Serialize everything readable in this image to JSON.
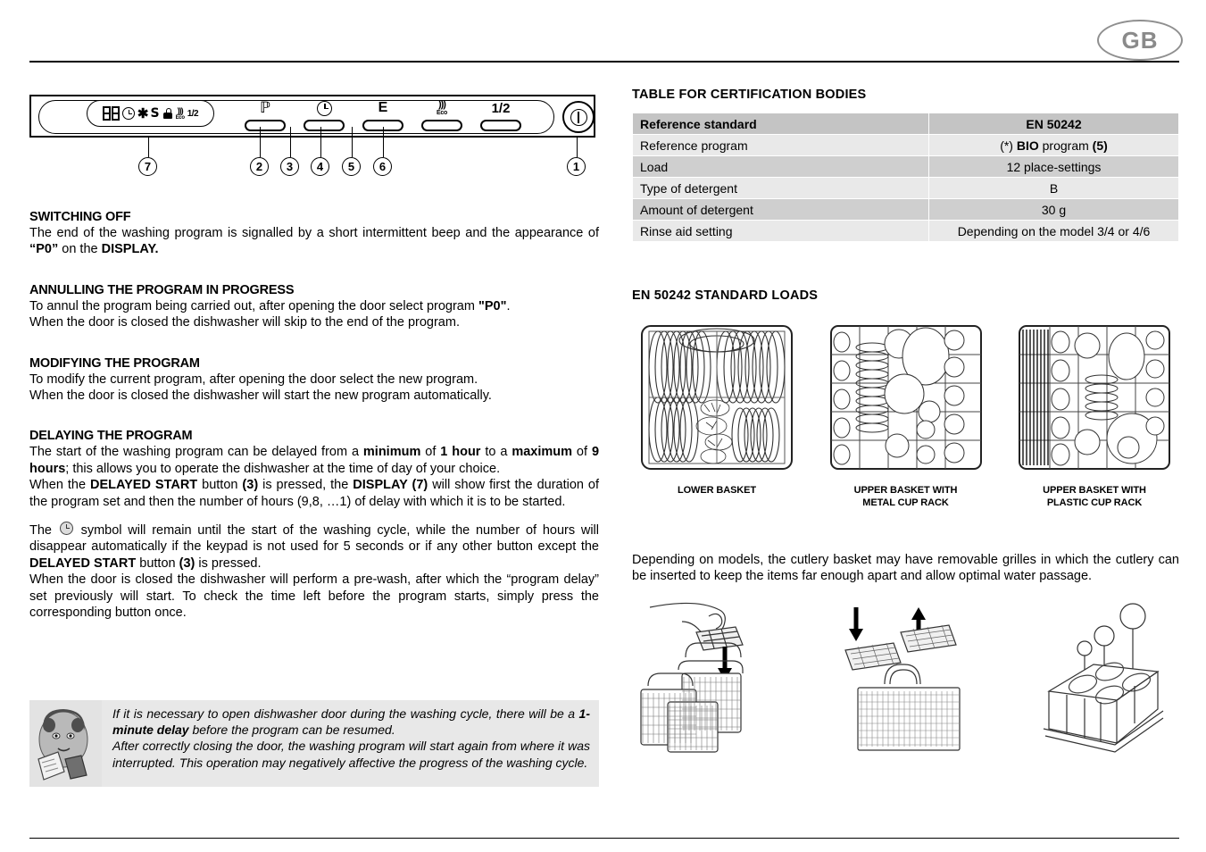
{
  "header": {
    "language_badge": "GB"
  },
  "control_panel": {
    "display_symbols": [
      {
        "name": "seven-segment-digits",
        "label": "88"
      },
      {
        "name": "delay-clock-icon",
        "label": "clock"
      },
      {
        "name": "rinse-aid-star-icon",
        "label": "*"
      },
      {
        "name": "salt-icon",
        "label": "S"
      },
      {
        "name": "tap-water-icon",
        "label": "tap"
      },
      {
        "name": "eco-icon",
        "label": "Eco"
      },
      {
        "name": "half-load-icon",
        "label": "1/2"
      }
    ],
    "buttons": [
      {
        "icon": "P",
        "name": "program-button",
        "callout": "2"
      },
      {
        "icon": "clock",
        "name": "delayed-start-button",
        "callout": "3"
      },
      {
        "icon": "E",
        "name": "extra-button",
        "callout": "4"
      },
      {
        "icon": "Eco",
        "name": "eco-button",
        "callout": "5"
      },
      {
        "icon": "1/2",
        "name": "half-load-button",
        "callout": "6"
      }
    ],
    "power_callout": "1",
    "display_callout": "7"
  },
  "sections": [
    {
      "heading": "SWITCHING OFF",
      "paragraphs": [
        "The end of the washing program is signalled by a short intermittent beep and the appearance of “P0” on the DISPLAY."
      ]
    },
    {
      "heading": "ANNULLING THE PROGRAM IN PROGRESS",
      "paragraphs": [
        "To annul the program being carried out, after opening the door select program \"P0\". When the door is closed the dishwasher will skip to the end of the program."
      ]
    },
    {
      "heading": "MODIFYING THE PROGRAM",
      "paragraphs": [
        "To modify the current program, after opening the door select the new program. When the door is closed the dishwasher will start the new program automatically."
      ]
    },
    {
      "heading": "DELAYING THE PROGRAM",
      "paragraphs": [
        "The start of the washing program can be delayed from a minimum of 1 hour to a maximum of 9 hours; this allows you to operate the dishwasher at the time of day of your choice.",
        "When the DELAYED START button (3) is pressed, the DISPLAY (7) will show first the duration of the program set and then the number of hours (9,8, …1) of delay with which it is to be started."
      ]
    }
  ],
  "switching_off": {
    "heading": "SWITCHING OFF",
    "t1": "The end of the washing program is signalled by a short intermittent beep and the appearance of ",
    "b1": "“P0”",
    "t2": " on the ",
    "b2": "DISPLAY."
  },
  "annulling": {
    "heading": "ANNULLING THE PROGRAM IN PROGRESS",
    "t1": "To annul the program being carried out, after opening the door select program ",
    "b1": "\"P0\"",
    "t2": ".",
    "line2": "When the door is closed the dishwasher will skip to the end of the program."
  },
  "modifying": {
    "heading": "MODIFYING THE PROGRAM",
    "line1": "To modify the current program, after opening the door select the new program.",
    "line2": "When the door is closed the dishwasher will start the new program automatically."
  },
  "delaying": {
    "heading": "DELAYING THE PROGRAM",
    "p1_a": "The start of the washing program can be delayed from a ",
    "p1_b1": "minimum",
    "p1_b": " of ",
    "p1_b2": "1 hour",
    "p1_c": " to a ",
    "p1_b3": "maximum",
    "p1_d": " of ",
    "p1_b4": "9 hours",
    "p1_e": "; this allows you to operate the dishwasher at the time of day of your choice.",
    "p2_a": "When the ",
    "p2_b1": "DELAYED START",
    "p2_b": " button ",
    "p2_b2": "(3)",
    "p2_c": " is pressed, the ",
    "p2_b3": "DISPLAY (7)",
    "p2_d": " will show first the duration of the program set and then the number of hours (9,8, …1) of delay with which it is to be started.",
    "p3_a": "The ",
    "p3_b": " symbol will remain until the start of the washing cycle, while the number of hours will disappear automatically if the keypad is not used for 5 seconds or if any other button except the ",
    "p3_b1": "DELAYED START",
    "p3_c": " button ",
    "p3_b2": "(3)",
    "p3_d": " is pressed.",
    "p4": "When the door is closed the dishwasher will perform a pre-wash, after which the “program delay” set previously will start. To check the time left before the program starts, simply press the corresponding button once."
  },
  "note": {
    "icon_name": "cartoon-woman-with-note-icon",
    "l1_a": "If it is necessary to open dishwasher door during the washing cycle, there will be a ",
    "l1_b": "1-minute delay",
    "l1_c": " before the program can be resumed.",
    "l2": "After correctly closing the door, the washing program will start again from where it was interrupted. This operation may negatively affective the progress of the washing cycle."
  },
  "cert_table": {
    "heading": "TABLE FOR CERTIFICATION BODIES",
    "rows": [
      {
        "key": "Reference standard",
        "value": "EN 50242",
        "header": true
      },
      {
        "key": "Reference program",
        "value_parts": [
          "(*) ",
          "BIO",
          " program ",
          "(5)"
        ]
      },
      {
        "key": "Load",
        "value": "12 place-settings"
      },
      {
        "key": "Type of detergent",
        "value": "B"
      },
      {
        "key": "Amount of detergent",
        "value": "30 g"
      },
      {
        "key": "Rinse aid setting",
        "value": "Depending on the model 3/4 or 4/6"
      }
    ]
  },
  "standard_loads": {
    "heading": "EN 50242 STANDARD LOADS",
    "items": [
      {
        "caption_line1": "LOWER BASKET",
        "caption_line2": "",
        "name": "lower-basket-diagram"
      },
      {
        "caption_line1": "UPPER BASKET WITH",
        "caption_line2": "METAL CUP RACK",
        "name": "upper-basket-metal-rack-diagram"
      },
      {
        "caption_line1": "UPPER BASKET WITH",
        "caption_line2": "PLASTIC CUP RACK",
        "name": "upper-basket-plastic-rack-diagram"
      }
    ]
  },
  "cutlery": {
    "paragraph": "Depending on models, the cutlery basket may have removable grilles in which the cutlery can be inserted to keep the items far enough apart and allow optimal water passage.",
    "diagrams": [
      {
        "name": "cutlery-basket-with-hand-diagram"
      },
      {
        "name": "cutlery-basket-removable-grille-diagram"
      },
      {
        "name": "glass-holder-basket-diagram"
      }
    ]
  }
}
